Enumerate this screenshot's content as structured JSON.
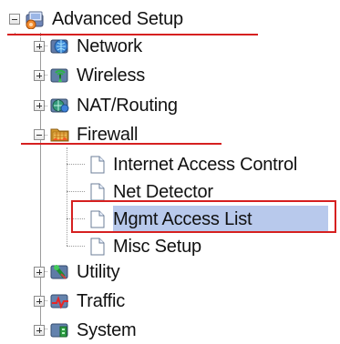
{
  "tree": {
    "root": {
      "label": "Advanced Setup",
      "icon": "computer-folder-icon",
      "expanded": true
    },
    "items": [
      {
        "label": "Network",
        "icon": "network-globe-icon",
        "expanded": false
      },
      {
        "label": "Wireless",
        "icon": "wireless-antenna-icon",
        "expanded": false
      },
      {
        "label": "NAT/Routing",
        "icon": "routing-globe-icon",
        "expanded": false
      },
      {
        "label": "Firewall",
        "icon": "firewall-folder-icon",
        "expanded": true
      },
      {
        "label": "Utility",
        "icon": "utility-folder-icon",
        "expanded": false
      },
      {
        "label": "Traffic",
        "icon": "traffic-chart-icon",
        "expanded": false
      },
      {
        "label": "System",
        "icon": "system-folder-icon",
        "expanded": false
      }
    ],
    "firewall_children": [
      {
        "label": "Internet Access Control",
        "icon": "page-icon",
        "selected": false
      },
      {
        "label": "Net Detector",
        "icon": "page-icon",
        "selected": false
      },
      {
        "label": "Mgmt Access List",
        "icon": "page-icon",
        "selected": true
      },
      {
        "label": "Misc Setup",
        "icon": "page-icon",
        "selected": false
      }
    ]
  },
  "colors": {
    "annotation_red": "#d62020",
    "selection_fill": "#b8c9ec",
    "tree_line": "#9c9c9c"
  }
}
